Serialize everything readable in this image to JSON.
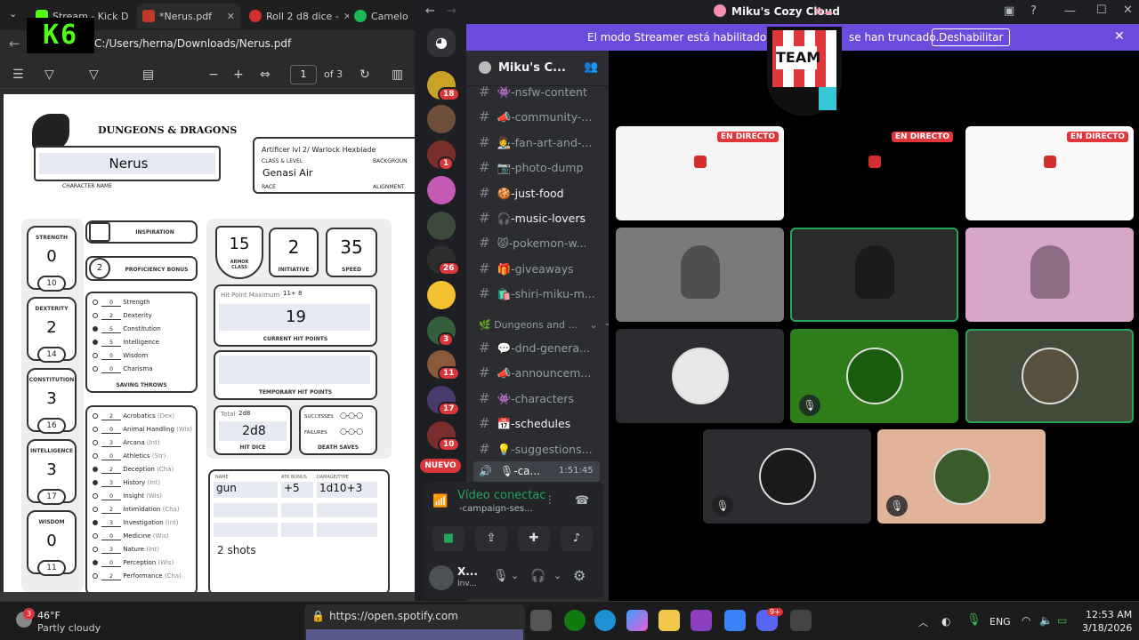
{
  "browser": {
    "tabs": [
      {
        "label": "Stream - Kick D"
      },
      {
        "label": "*Nerus.pdf"
      },
      {
        "label": "Roll 2 d8 dice -"
      },
      {
        "label": "Camelo"
      }
    ],
    "address": "C:/Users/herna/Downloads/Nerus.pdf",
    "page_current": "1",
    "page_total": "of 3",
    "kick_logo": "K6"
  },
  "sheet": {
    "logo": "DUNGEONS & DRAGONS",
    "character_name": "Nerus",
    "character_name_label": "CHARACTER NAME",
    "class_level": "Artificer lvl 2/ Warlock Hexblade",
    "class_level_label": "CLASS & LEVEL",
    "background_label": "BACKGROUN",
    "race": "Genasi Air",
    "race_label": "RACE",
    "alignment_label": "ALIGNMENT",
    "inspiration_label": "INSPIRATION",
    "proficiency_bonus": "2",
    "proficiency_label": "PROFICIENCY BONUS",
    "armor_class": "15",
    "armor_label": "ARMOR CLASS",
    "initiative": "2",
    "initiative_label": "INITIATIVE",
    "speed": "35",
    "speed_label": "SPEED",
    "hp_max_label": "Hit Point Maximum",
    "hp_max": "11+ 8",
    "hp_current": "19",
    "hp_current_label": "CURRENT HIT POINTS",
    "hp_temp_label": "TEMPORARY HIT POINTS",
    "hit_dice_total_label": "Total",
    "hit_dice_total": "2d8",
    "hit_dice": "2d8",
    "hit_dice_label": "HIT DICE",
    "death_successes": "SUCCESSES",
    "death_failures": "FAILURES",
    "death_saves_label": "DEATH SAVES",
    "abilities": [
      {
        "name": "STRENGTH",
        "mod": "0",
        "score": "10"
      },
      {
        "name": "DEXTERITY",
        "mod": "2",
        "score": "14"
      },
      {
        "name": "CONSTITUTION",
        "mod": "3",
        "score": "16"
      },
      {
        "name": "INTELLIGENCE",
        "mod": "3",
        "score": "17"
      },
      {
        "name": "WISDOM",
        "mod": "0",
        "score": "11"
      }
    ],
    "saving_throws_label": "SAVING THROWS",
    "saving_throws": [
      {
        "val": "0",
        "name": "Strength",
        "prof": false
      },
      {
        "val": "2",
        "name": "Dexterity",
        "prof": false
      },
      {
        "val": "5",
        "name": "Constitution",
        "prof": true
      },
      {
        "val": "5",
        "name": "Intelligence",
        "prof": true
      },
      {
        "val": "0",
        "name": "Wisdom",
        "prof": false
      },
      {
        "val": "0",
        "name": "Charisma",
        "prof": false
      }
    ],
    "skills": [
      {
        "val": "2",
        "name": "Acrobatics",
        "attr": "(Dex)",
        "prof": false
      },
      {
        "val": "0",
        "name": "Animal Handling",
        "attr": "(Wis)",
        "prof": false
      },
      {
        "val": "3",
        "name": "Arcana",
        "attr": "(Int)",
        "prof": false
      },
      {
        "val": "0",
        "name": "Athletics",
        "attr": "(Str)",
        "prof": false
      },
      {
        "val": "2",
        "name": "Deception",
        "attr": "(Cha)",
        "prof": true
      },
      {
        "val": "3",
        "name": "History",
        "attr": "(Int)",
        "prof": true
      },
      {
        "val": "0",
        "name": "Insight",
        "attr": "(Wis)",
        "prof": false
      },
      {
        "val": "2",
        "name": "Intimidation",
        "attr": "(Cha)",
        "prof": false
      },
      {
        "val": "3",
        "name": "Investigation",
        "attr": "(Int)",
        "prof": true
      },
      {
        "val": "0",
        "name": "Medicine",
        "attr": "(Wis)",
        "prof": false
      },
      {
        "val": "3",
        "name": "Nature",
        "attr": "(Int)",
        "prof": false
      },
      {
        "val": "0",
        "name": "Perception",
        "attr": "(Wis)",
        "prof": true
      },
      {
        "val": "2",
        "name": "Performance",
        "attr": "(Cha)",
        "prof": false
      }
    ],
    "attacks_headers": [
      "NAME",
      "ATK BONUS",
      "DAMAGE/TYPE"
    ],
    "attack": {
      "name": "gun",
      "bonus": "+5",
      "damage": "1d10+3"
    },
    "attack_note": "2 shots"
  },
  "discord": {
    "window_title": "Miku's Cozy Cloud",
    "banner_text_left": "El modo Streamer está habilitado. Los n",
    "banner_text_right": "se han truncado.",
    "banner_button": "Deshabilitar",
    "server_name": "Miku's C...",
    "channels": [
      {
        "icon": "#",
        "name": "👾-nsfw-content",
        "unread": false
      },
      {
        "icon": "#",
        "name": "📣-community-...",
        "unread": false
      },
      {
        "icon": "#",
        "name": "👩‍🎨-fan-art-and-...",
        "unread": false
      },
      {
        "icon": "#",
        "name": "📷-photo-dump",
        "unread": false
      },
      {
        "icon": "#",
        "name": "🍪-just-food",
        "unread": true
      },
      {
        "icon": "#",
        "name": "🎧-music-lovers",
        "unread": true
      },
      {
        "icon": "#",
        "name": "😾-pokemon-w...",
        "unread": false
      },
      {
        "icon": "#",
        "name": "🎁-giveaways",
        "unread": false
      },
      {
        "icon": "#",
        "name": "🛍️-shiri-miku-m...",
        "unread": false
      }
    ],
    "category": "Dungeons and ...",
    "category_channels": [
      {
        "icon": "#",
        "name": "💬-dnd-genera...",
        "unread": false
      },
      {
        "icon": "#",
        "name": "📣-announcem...",
        "unread": false
      },
      {
        "icon": "#",
        "name": "👾-characters",
        "unread": false
      },
      {
        "icon": "#",
        "name": "📅-schedules",
        "unread": true
      },
      {
        "icon": "#",
        "name": "💡-suggestions...",
        "unread": false
      }
    ],
    "voice_channel": "🎙-ca...",
    "voice_timer": "1:51:45",
    "voice_status": "Vídeo conectac",
    "voice_channel_full": "-campaign-ses...",
    "user_name": "X...",
    "user_status": "Inv...",
    "server_badges": [
      "18",
      "1",
      "26",
      "3",
      "11",
      "17",
      "10",
      "18"
    ],
    "new_label": "NUEVO",
    "live_label": "EN DIRECTO",
    "team_logo": "TEAM"
  },
  "taskbar": {
    "weather_temp": "46°F",
    "weather_desc": "Partly cloudy",
    "weather_badge": "3",
    "spotify_url": "https://open.spotify.com",
    "lang": "ENG",
    "time": "12:53 AM",
    "date": "3/18/2026",
    "discord_badge": "9+"
  },
  "colors": {
    "accent": "#5865f2",
    "banner": "#6a4bdb",
    "live": "#e0353b",
    "speaking": "#23a55a"
  }
}
